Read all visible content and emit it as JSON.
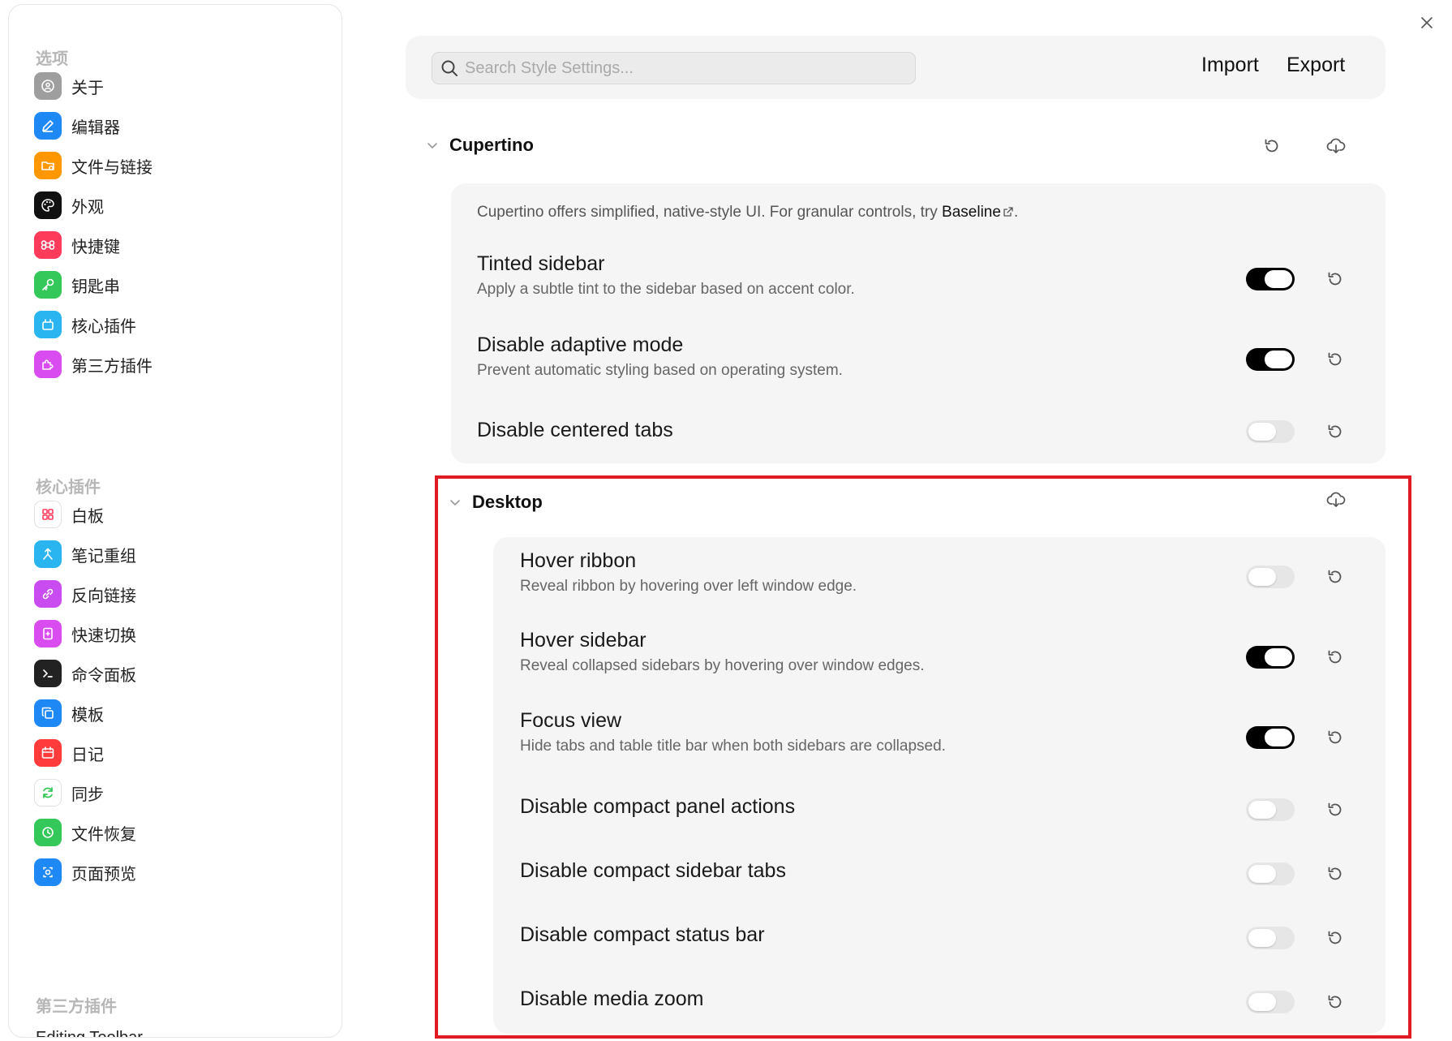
{
  "sidebar": {
    "sections": [
      {
        "heading": "选项",
        "items": [
          {
            "label": "关于",
            "icon": "info-icon",
            "color": "#9e9e9e"
          },
          {
            "label": "编辑器",
            "icon": "pencil-icon",
            "color": "#1e88f5"
          },
          {
            "label": "文件与链接",
            "icon": "folder-icon",
            "color": "#ff9800"
          },
          {
            "label": "外观",
            "icon": "palette-icon",
            "color": "#111111"
          },
          {
            "label": "快捷键",
            "icon": "command-icon",
            "color": "#ff3b5c"
          },
          {
            "label": "钥匙串",
            "icon": "key-icon",
            "color": "#34c759"
          },
          {
            "label": "核心插件",
            "icon": "plugin-icon",
            "color": "#2ab5f0"
          },
          {
            "label": "第三方插件",
            "icon": "puzzle-icon",
            "color": "#d94cf0"
          }
        ]
      },
      {
        "heading": "核心插件",
        "items": [
          {
            "label": "白板",
            "icon": "grid-icon",
            "color": "#ff3b5c"
          },
          {
            "label": "笔记重组",
            "icon": "merge-icon",
            "color": "#2ab5f0"
          },
          {
            "label": "反向链接",
            "icon": "link-icon",
            "color": "#c94cf0"
          },
          {
            "label": "快速切换",
            "icon": "switch-icon",
            "color": "#d94cf0"
          },
          {
            "label": "命令面板",
            "icon": "terminal-icon",
            "color": "#222222"
          },
          {
            "label": "模板",
            "icon": "copy-icon",
            "color": "#1e88f5"
          },
          {
            "label": "日记",
            "icon": "calendar-icon",
            "color": "#ff3b3b"
          },
          {
            "label": "同步",
            "icon": "sync-icon",
            "color": "#34c759"
          },
          {
            "label": "文件恢复",
            "icon": "history-icon",
            "color": "#34c759"
          },
          {
            "label": "页面预览",
            "icon": "preview-icon",
            "color": "#1e88f5"
          }
        ]
      },
      {
        "heading": "第三方插件",
        "items": []
      }
    ],
    "cut_item": "Editing Toolbar"
  },
  "search": {
    "placeholder": "Search Style Settings..."
  },
  "toolbar": {
    "import_label": "Import",
    "export_label": "Export"
  },
  "cupertino": {
    "title": "Cupertino",
    "description_prefix": "Cupertino offers simplified, native-style UI. For granular controls, try ",
    "description_link": "Baseline",
    "description_suffix": ".",
    "settings": [
      {
        "title": "Tinted sidebar",
        "desc": "Apply a subtle tint to the sidebar based on accent color.",
        "on": true
      },
      {
        "title": "Disable adaptive mode",
        "desc": "Prevent automatic styling based on operating system.",
        "on": true
      },
      {
        "title": "Disable centered tabs",
        "desc": "",
        "on": false
      }
    ]
  },
  "desktop": {
    "title": "Desktop",
    "settings": [
      {
        "title": "Hover ribbon",
        "desc": "Reveal ribbon by hovering over left window edge.",
        "on": false
      },
      {
        "title": "Hover sidebar",
        "desc": "Reveal collapsed sidebars by hovering over window edges.",
        "on": true
      },
      {
        "title": "Focus view",
        "desc": "Hide tabs and table title bar when both sidebars are collapsed.",
        "on": true
      },
      {
        "title": "Disable compact panel actions",
        "desc": "",
        "on": false
      },
      {
        "title": "Disable compact sidebar tabs",
        "desc": "",
        "on": false
      },
      {
        "title": "Disable compact status bar",
        "desc": "",
        "on": false
      },
      {
        "title": "Disable media zoom",
        "desc": "",
        "on": false
      }
    ]
  },
  "colors": {
    "highlight": "#e01b24",
    "toggle_on": "#000000",
    "toggle_off": "#e6e6e6",
    "panel_bg": "#f5f5f5"
  }
}
